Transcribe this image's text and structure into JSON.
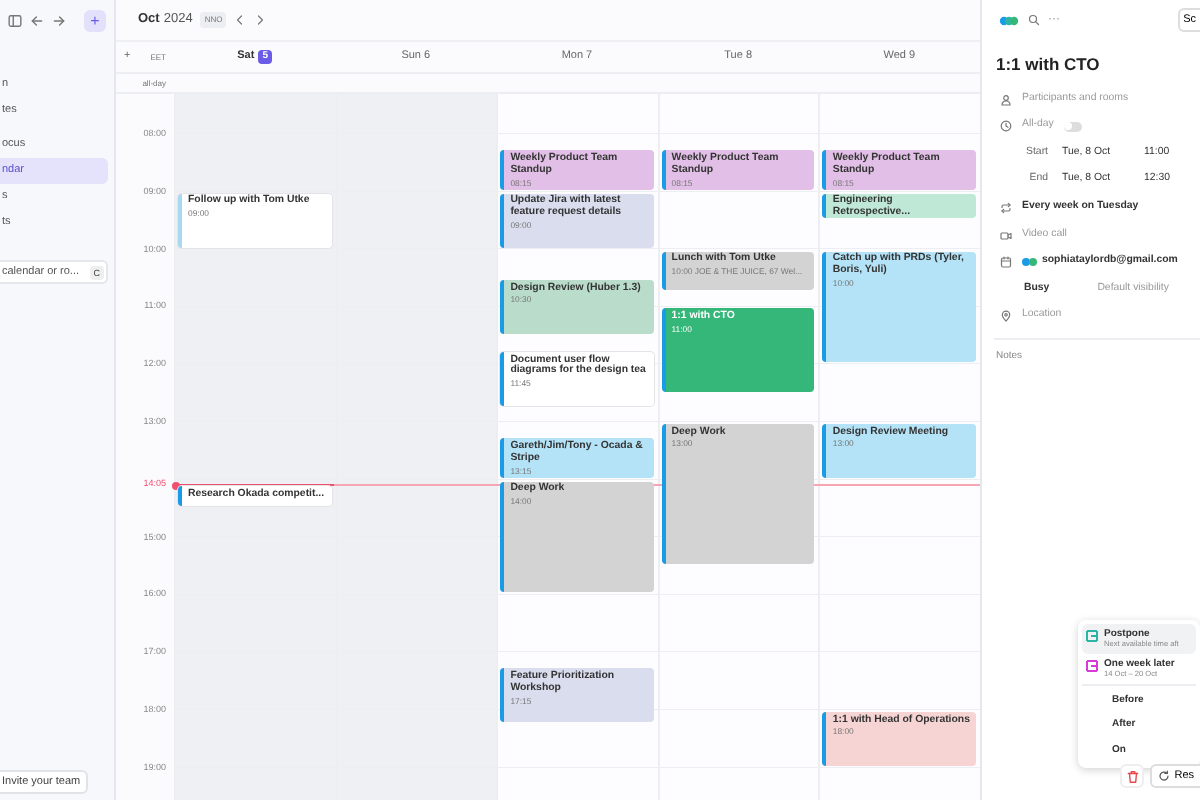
{
  "sidebar": {
    "add_button": "+",
    "items": [
      {
        "label": "n",
        "selected": false
      },
      {
        "label": "tes",
        "selected": false
      },
      {
        "label": "ocus",
        "selected": false
      },
      {
        "label": "ndar",
        "selected": true
      },
      {
        "label": "s",
        "selected": false
      },
      {
        "label": "ts",
        "selected": false
      }
    ],
    "search": {
      "placeholder": "calendar or ro...",
      "shortcut": "C"
    },
    "invite_button": "Invite your team"
  },
  "toolbar": {
    "month": "Oct",
    "year": "2024",
    "badge": "NNO"
  },
  "day_header": {
    "add": "+",
    "timezone": "EET",
    "all_day": "all-day",
    "days": [
      {
        "weekday": "Sat",
        "date": "5",
        "today": true,
        "weekend": true,
        "events": [
          {
            "title": "Follow up with Tom Utke",
            "time": "09:00",
            "color": "#ffffff",
            "selected": false
          },
          {
            "title": "Research Okada competit...",
            "color": "#ffffff",
            "selected": false
          }
        ]
      },
      {
        "weekday": "Sun",
        "date": "6",
        "today": false,
        "weekend": true
      },
      {
        "weekday": "Mon",
        "date": "7",
        "today": false,
        "weekend": false,
        "events": [
          {
            "title": "Weekly Product Team Standup",
            "time": "08:15",
            "color": "#e1bfe6",
            "selected": false
          },
          {
            "title": "Update Jira with latest feature request details",
            "time": "09:00",
            "color": "#d9ddee",
            "selected": false
          },
          {
            "title": "Design Review (Huber 1.3)",
            "time": "10:30",
            "color": "#badccb",
            "selected": false
          },
          {
            "title": "Document user flow diagrams for the design tea",
            "time": "11:45",
            "color": "#ffffff",
            "selected": false
          },
          {
            "title": "Gareth/Jim/Tony - Ocada & Stripe",
            "time": "13:15",
            "color": "#b4e2f6",
            "selected": false
          },
          {
            "title": "Deep Work",
            "time": "14:00",
            "color": "#d3d3d3",
            "selected": false
          },
          {
            "title": "Feature Prioritization Workshop",
            "time": "17:15",
            "color": "#d9ddee",
            "selected": false
          }
        ]
      },
      {
        "weekday": "Tue",
        "date": "8",
        "today": false,
        "weekend": false,
        "events": [
          {
            "title": "Weekly Product Team Standup",
            "time": "08:15",
            "color": "#e1bfe6",
            "selected": false
          },
          {
            "title": "Lunch with Tom Utke",
            "time": "10:00 JOE & THE JUICE, 67 Wel...",
            "color": "#d3d3d3",
            "selected": false
          },
          {
            "title": "1:1 with CTO",
            "time": "11:00",
            "color": "#35b779",
            "selected": true
          },
          {
            "title": "Deep Work",
            "time": "13:00",
            "color": "#d3d3d3",
            "selected": false
          }
        ]
      },
      {
        "weekday": "Wed",
        "date": "9",
        "today": false,
        "weekend": false,
        "events": [
          {
            "title": "Weekly Product Team Standup",
            "time": "08:15",
            "color": "#e1bfe6",
            "selected": false
          },
          {
            "title": "Engineering Retrospective...",
            "color": "#bfe9d6",
            "selected": false
          },
          {
            "title": "Catch up with PRDs (Tyler, Boris, Yuli)",
            "time": "10:00",
            "color": "#b4e2f6",
            "selected": false
          },
          {
            "title": "Design Review Meeting",
            "time": "13:00",
            "color": "#b4e2f6",
            "selected": false
          },
          {
            "title": "1:1 with Head of Operations",
            "time": "18:00",
            "color": "#f6d4d4",
            "selected": false
          }
        ]
      }
    ]
  },
  "hours": [
    "08:00",
    "09:00",
    "10:00",
    "11:00",
    "12:00",
    "13:00",
    "15:00",
    "16:00",
    "17:00",
    "18:00",
    "19:00"
  ],
  "now": "14:05",
  "panel": {
    "more": "···",
    "top_button": "Sc",
    "title": "1:1 with CTO",
    "rows": [
      {
        "kind": "participants",
        "label": "Participants and rooms"
      },
      {
        "kind": "all_day",
        "label": "All-day",
        "on": false
      },
      {
        "kind": "time",
        "label": "Start",
        "date": "Tue, 8 Oct",
        "time": "11:00"
      },
      {
        "kind": "time",
        "label": "End",
        "date": "Tue, 8 Oct",
        "time": "12:30"
      },
      {
        "kind": "repeat",
        "label": "Every week on Tuesday"
      },
      {
        "kind": "video",
        "label": "Video call"
      },
      {
        "kind": "calendar",
        "label": "sophiataylordb@gmail.com"
      },
      {
        "kind": "status",
        "label": "Busy",
        "value": "Default visibility"
      },
      {
        "kind": "location",
        "label": "Location"
      }
    ],
    "notes": "Notes",
    "footer_button": "Res"
  },
  "menu": {
    "items": [
      {
        "kind": "option",
        "title": "Postpone",
        "subtitle": "Next available time aft",
        "color": "#2bb5a7",
        "selected": true
      },
      {
        "kind": "option",
        "title": "One week later",
        "subtitle": "14 Oct – 20 Oct",
        "color": "#d63ad9",
        "selected": false
      },
      {
        "kind": "plain",
        "title": "Before",
        "selected": false
      },
      {
        "kind": "plain",
        "title": "After",
        "selected": false
      },
      {
        "kind": "plain",
        "title": "On",
        "selected": false
      }
    ]
  }
}
